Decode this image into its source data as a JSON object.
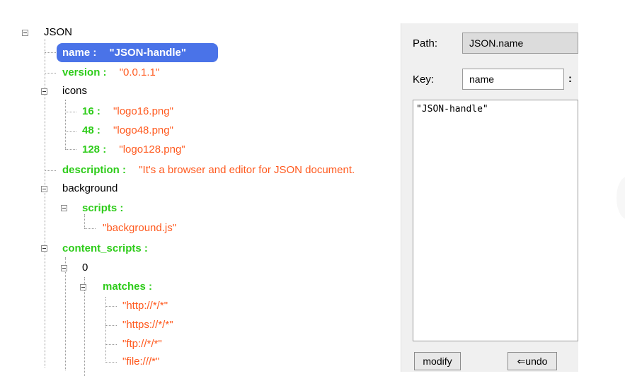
{
  "tree": {
    "root": "JSON",
    "selected": {
      "key": "name",
      "sep": ":",
      "value": "\"JSON-handle\""
    },
    "rows": [
      {
        "id": "version",
        "key": "version",
        "sep": ":",
        "value": "\"0.0.1.1\""
      },
      {
        "id": "icons",
        "key": "icons"
      },
      {
        "id": "icon16",
        "key": "16",
        "sep": ":",
        "value": "\"logo16.png\""
      },
      {
        "id": "icon48",
        "key": "48",
        "sep": ":",
        "value": "\"logo48.png\""
      },
      {
        "id": "icon128",
        "key": "128",
        "sep": ":",
        "value": "\"logo128.png\""
      },
      {
        "id": "description",
        "key": "description",
        "sep": ":",
        "value": "\"It's a browser and editor for JSON document."
      },
      {
        "id": "background",
        "key": "background"
      },
      {
        "id": "scripts",
        "key": "scripts",
        "sep": ":"
      },
      {
        "id": "bgjs",
        "value": "\"background.js\""
      },
      {
        "id": "content_scripts",
        "key": "content_scripts",
        "sep": ":"
      },
      {
        "id": "idx0",
        "key": "0"
      },
      {
        "id": "matches",
        "key": "matches",
        "sep": ":"
      },
      {
        "id": "m1",
        "value": "\"http://*/*\""
      },
      {
        "id": "m2",
        "value": "\"https://*/*\""
      },
      {
        "id": "m3",
        "value": "\"ftp://*/*\""
      },
      {
        "id": "m4",
        "value": "\"file:///*\""
      }
    ]
  },
  "panel": {
    "path_label": "Path:",
    "path_value": "JSON.name",
    "key_label": "Key:",
    "key_value": "name",
    "key_colon": ":",
    "value_text": "\"JSON-handle\"",
    "modify_label": "modify",
    "undo_label": "⇐undo"
  },
  "colors": {
    "key": "#2ecc1a",
    "value": "#ff5a1f",
    "selection": "#4a73e8"
  }
}
